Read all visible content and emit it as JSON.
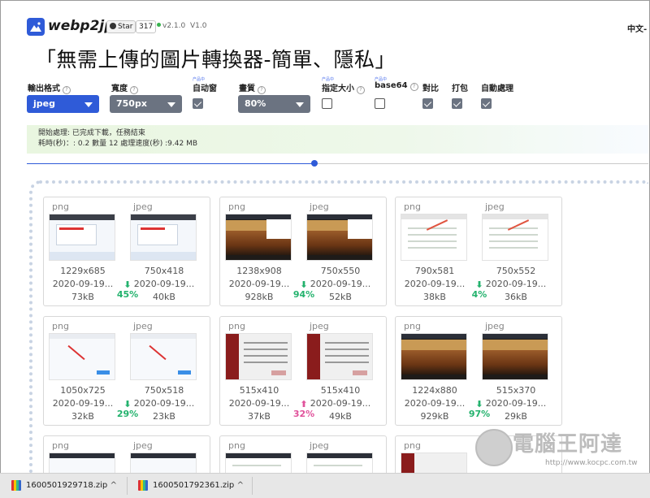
{
  "header": {
    "brand": "webp2jpg",
    "github_star_label": "Star",
    "github_star_count": "317",
    "version": "v2.1.0",
    "version_alt": "V1.0",
    "language": "中文-",
    "title": "「無需上傳的圖片轉換器-簡單、隱私」"
  },
  "options": {
    "output_format_label": "輸出格式",
    "output_format_value": "jpeg",
    "width_label": "寬度",
    "width_value": "750px",
    "auto_window_label": "自动窗",
    "quality_label": "畫質",
    "quality_value": "80%",
    "specified_size_label": "指定大小",
    "base64_label": "base64",
    "compare_label": "對比",
    "pack_label": "打包",
    "auto_process_label": "自動處理",
    "tag_text": "产品中"
  },
  "status": {
    "line1": "開始處理: 已完成下載，任務結束",
    "line2": "耗時(秒)：: 0.2 數量 12 處理速度(秒) :9.42 MB"
  },
  "slider": {
    "value_fraction": 0.46
  },
  "cards": [
    {
      "left": {
        "format": "png",
        "dims": "1229x685",
        "date": "2020-09-19...",
        "size": "73kB"
      },
      "right": {
        "format": "jpeg",
        "dims": "750x418",
        "date": "2020-09-19...",
        "size": "40kB"
      },
      "change": "45%",
      "direction": "down"
    },
    {
      "left": {
        "format": "png",
        "dims": "1238x908",
        "date": "2020-09-19...",
        "size": "928kB"
      },
      "right": {
        "format": "jpeg",
        "dims": "750x550",
        "date": "2020-09-19...",
        "size": "52kB"
      },
      "change": "94%",
      "direction": "down"
    },
    {
      "left": {
        "format": "png",
        "dims": "790x581",
        "date": "2020-09-19...",
        "size": "38kB"
      },
      "right": {
        "format": "jpeg",
        "dims": "750x552",
        "date": "2020-09-19...",
        "size": "36kB"
      },
      "change": "4%",
      "direction": "down"
    },
    {
      "left": {
        "format": "png",
        "dims": "1050x725",
        "date": "2020-09-19...",
        "size": "32kB"
      },
      "right": {
        "format": "jpeg",
        "dims": "750x518",
        "date": "2020-09-19...",
        "size": "23kB"
      },
      "change": "29%",
      "direction": "down"
    },
    {
      "left": {
        "format": "png",
        "dims": "515x410",
        "date": "2020-09-19...",
        "size": "37kB"
      },
      "right": {
        "format": "jpeg",
        "dims": "515x410",
        "date": "2020-09-19...",
        "size": "49kB"
      },
      "change": "32%",
      "direction": "up"
    },
    {
      "left": {
        "format": "png",
        "dims": "1224x880",
        "date": "2020-09-19...",
        "size": "929kB"
      },
      "right": {
        "format": "jpeg",
        "dims": "515x370",
        "date": "2020-09-19...",
        "size": "29kB"
      },
      "change": "97%",
      "direction": "down"
    },
    {
      "left": {
        "format": "png"
      },
      "right": {
        "format": "jpeg"
      }
    },
    {
      "left": {
        "format": "png"
      },
      "right": {
        "format": "jpeg"
      }
    },
    {
      "left": {
        "format": "png"
      }
    }
  ],
  "downloads": [
    {
      "name": "1600501929718.zip"
    },
    {
      "name": "1600501792361.zip"
    }
  ],
  "watermark": {
    "text": "電腦王阿達",
    "url": "http://www.kocpc.com.tw"
  },
  "colors": {
    "accent": "#2f5bd8",
    "down": "#23b26d",
    "up": "#e0529b",
    "select_gray": "#6b7381"
  }
}
